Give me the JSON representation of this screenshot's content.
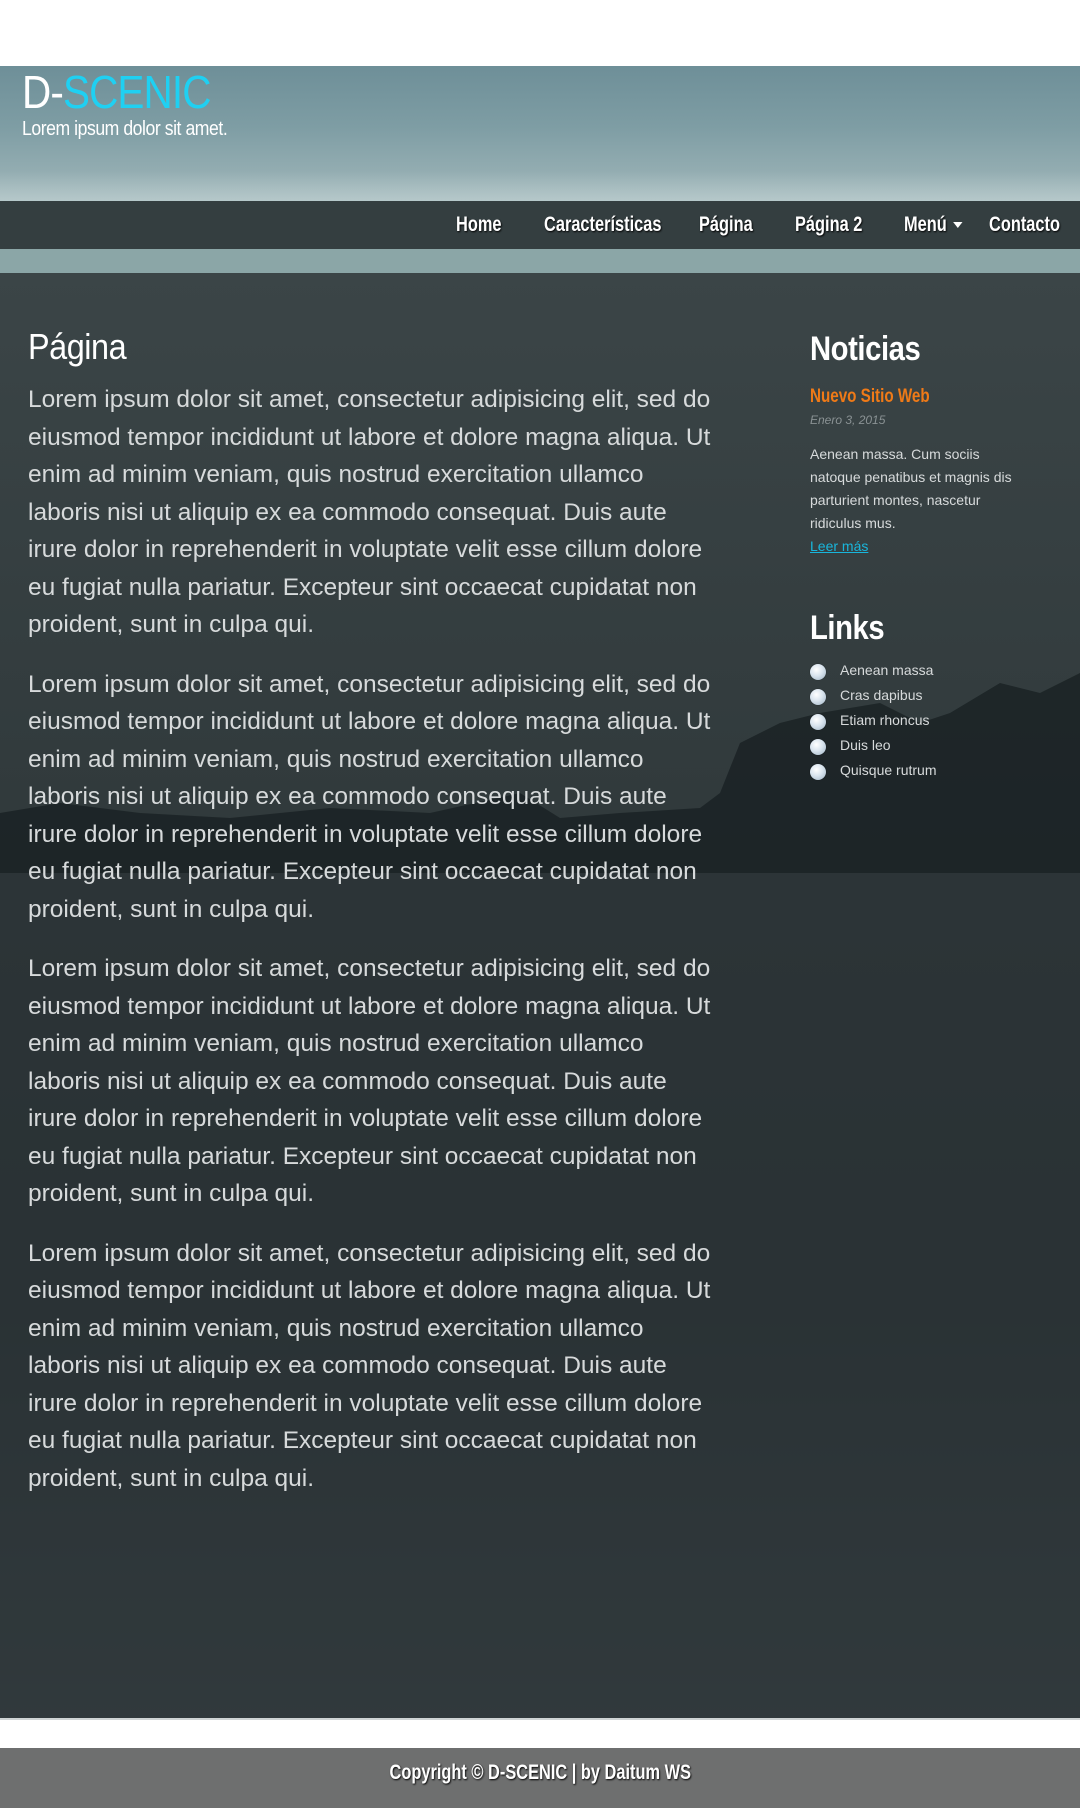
{
  "header": {
    "logo_part1": "D-",
    "logo_part2": "SCENIC",
    "tagline": "Lorem ipsum dolor sit amet."
  },
  "nav": {
    "items": [
      {
        "label": "Home"
      },
      {
        "label": "Características"
      },
      {
        "label": "Página"
      },
      {
        "label": "Página 2"
      },
      {
        "label": "Menú"
      },
      {
        "label": "Contacto"
      }
    ]
  },
  "main": {
    "title": "Página",
    "paragraphs": [
      "Lorem ipsum dolor sit amet, consectetur adipisicing elit, sed do eiusmod tempor incididunt ut labore et dolore magna aliqua. Ut enim ad minim veniam, quis nostrud exercitation ullamco laboris nisi ut aliquip ex ea commodo consequat. Duis aute irure dolor in reprehenderit in voluptate velit esse cillum dolore eu fugiat nulla pariatur. Excepteur sint occaecat cupidatat non proident, sunt in culpa qui.",
      "Lorem ipsum dolor sit amet, consectetur adipisicing elit, sed do eiusmod tempor incididunt ut labore et dolore magna aliqua. Ut enim ad minim veniam, quis nostrud exercitation ullamco laboris nisi ut aliquip ex ea commodo consequat. Duis aute irure dolor in reprehenderit in voluptate velit esse cillum dolore eu fugiat nulla pariatur. Excepteur sint occaecat cupidatat non proident, sunt in culpa qui.",
      "Lorem ipsum dolor sit amet, consectetur adipisicing elit, sed do eiusmod tempor incididunt ut labore et dolore magna aliqua. Ut enim ad minim veniam, quis nostrud exercitation ullamco laboris nisi ut aliquip ex ea commodo consequat. Duis aute irure dolor in reprehenderit in voluptate velit esse cillum dolore eu fugiat nulla pariatur. Excepteur sint occaecat cupidatat non proident, sunt in culpa qui.",
      "Lorem ipsum dolor sit amet, consectetur adipisicing elit, sed do eiusmod tempor incididunt ut labore et dolore magna aliqua. Ut enim ad minim veniam, quis nostrud exercitation ullamco laboris nisi ut aliquip ex ea commodo consequat. Duis aute irure dolor in reprehenderit in voluptate velit esse cillum dolore eu fugiat nulla pariatur. Excepteur sint occaecat cupidatat non proident, sunt in culpa qui."
    ]
  },
  "sidebar": {
    "news_heading": "Noticias",
    "news_item": {
      "title": "Nuevo Sitio Web",
      "date": "Enero 3, 2015",
      "text": "Aenean massa. Cum sociis natoque penatibus et magnis dis parturient montes, nascetur ridiculus mus.",
      "more": "Leer más"
    },
    "links_heading": "Links",
    "links": [
      {
        "label": "Aenean massa"
      },
      {
        "label": "Cras dapibus"
      },
      {
        "label": "Etiam rhoncus"
      },
      {
        "label": "Duis leo"
      },
      {
        "label": "Quisque rutrum"
      }
    ]
  },
  "footer": {
    "text": "Copyright © D-SCENIC | by Daitum WS"
  },
  "colors": {
    "accent": "#1fd0f2",
    "news_title": "#f07a17",
    "nav_bg": "#343e40",
    "footer_bg": "#6e6f6f"
  }
}
